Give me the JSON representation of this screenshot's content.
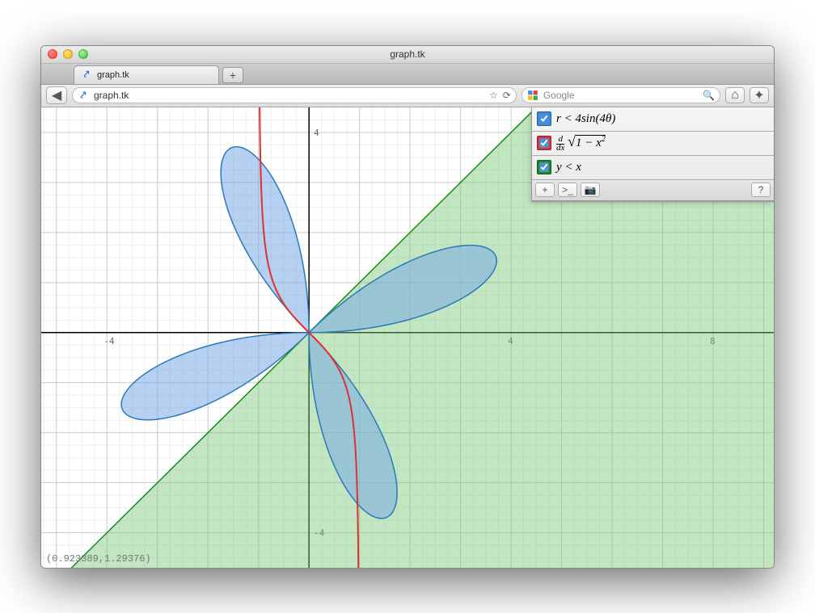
{
  "window": {
    "title": "graph.tk"
  },
  "tab": {
    "label": "graph.tk",
    "favicon_glyph": "⤤"
  },
  "url": {
    "text": "graph.tk",
    "favicon_glyph": "⤤",
    "star_glyph": "☆",
    "reload_glyph": "⟳"
  },
  "search": {
    "placeholder": "Google",
    "mag_glyph": "🔍"
  },
  "buttons": {
    "newtab": "+",
    "back": "◀",
    "home": "⌂",
    "bookmarks": "✦"
  },
  "panel": {
    "equations": [
      {
        "color": "#3a8cd8",
        "checked": true,
        "html": "r < 4sin(4θ)"
      },
      {
        "color": "#e03030",
        "checked": true,
        "html": "d/dx √(1 − x²)"
      },
      {
        "color": "#1a8a1a",
        "checked": true,
        "html": "y < x"
      }
    ],
    "toolbar": {
      "add": "+",
      "terminal": ">_",
      "camera": "📷",
      "help": "?"
    }
  },
  "coords": "(0.923389,1.29376)",
  "axes": {
    "x_ticks": [
      -4,
      4,
      8
    ],
    "y_ticks": [
      -4,
      4
    ]
  }
}
